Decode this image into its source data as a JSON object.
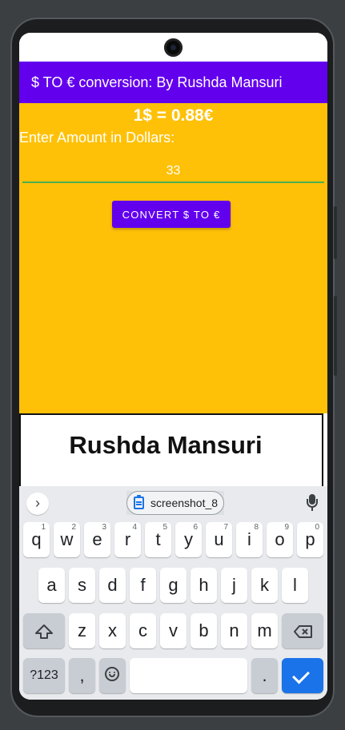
{
  "app": {
    "title": "$ TO € conversion: By Rushda Mansuri",
    "rate_text": "1$ = 0.88€",
    "amount_label": "Enter Amount in Dollars:",
    "amount_value": "33",
    "convert_button": "CONVERT $ TO €",
    "signature_text": "Rushda Mansuri"
  },
  "colors": {
    "app_bar": "#6200ee",
    "content_bg": "#ffc107",
    "underline": "#4caf50",
    "enter_key": "#1a73e8"
  },
  "keyboard": {
    "suggestion_chip": "screenshot_8",
    "suggestion_icon": "clipboard-icon",
    "expand_icon": "chevron-right-icon",
    "mic_icon": "mic-icon",
    "row1": [
      "q",
      "w",
      "e",
      "r",
      "t",
      "y",
      "u",
      "i",
      "o",
      "p"
    ],
    "row1_hints": [
      "1",
      "2",
      "3",
      "4",
      "5",
      "6",
      "7",
      "8",
      "9",
      "0"
    ],
    "row2": [
      "a",
      "s",
      "d",
      "f",
      "g",
      "h",
      "j",
      "k",
      "l"
    ],
    "row3": [
      "z",
      "x",
      "c",
      "v",
      "b",
      "n",
      "m"
    ],
    "shift_icon": "shift-icon",
    "backspace_icon": "backspace-icon",
    "symbols_key": "?123",
    "comma_key": ",",
    "emoji_icon": "emoji-icon",
    "period_key": ".",
    "enter_icon": "check-icon"
  }
}
